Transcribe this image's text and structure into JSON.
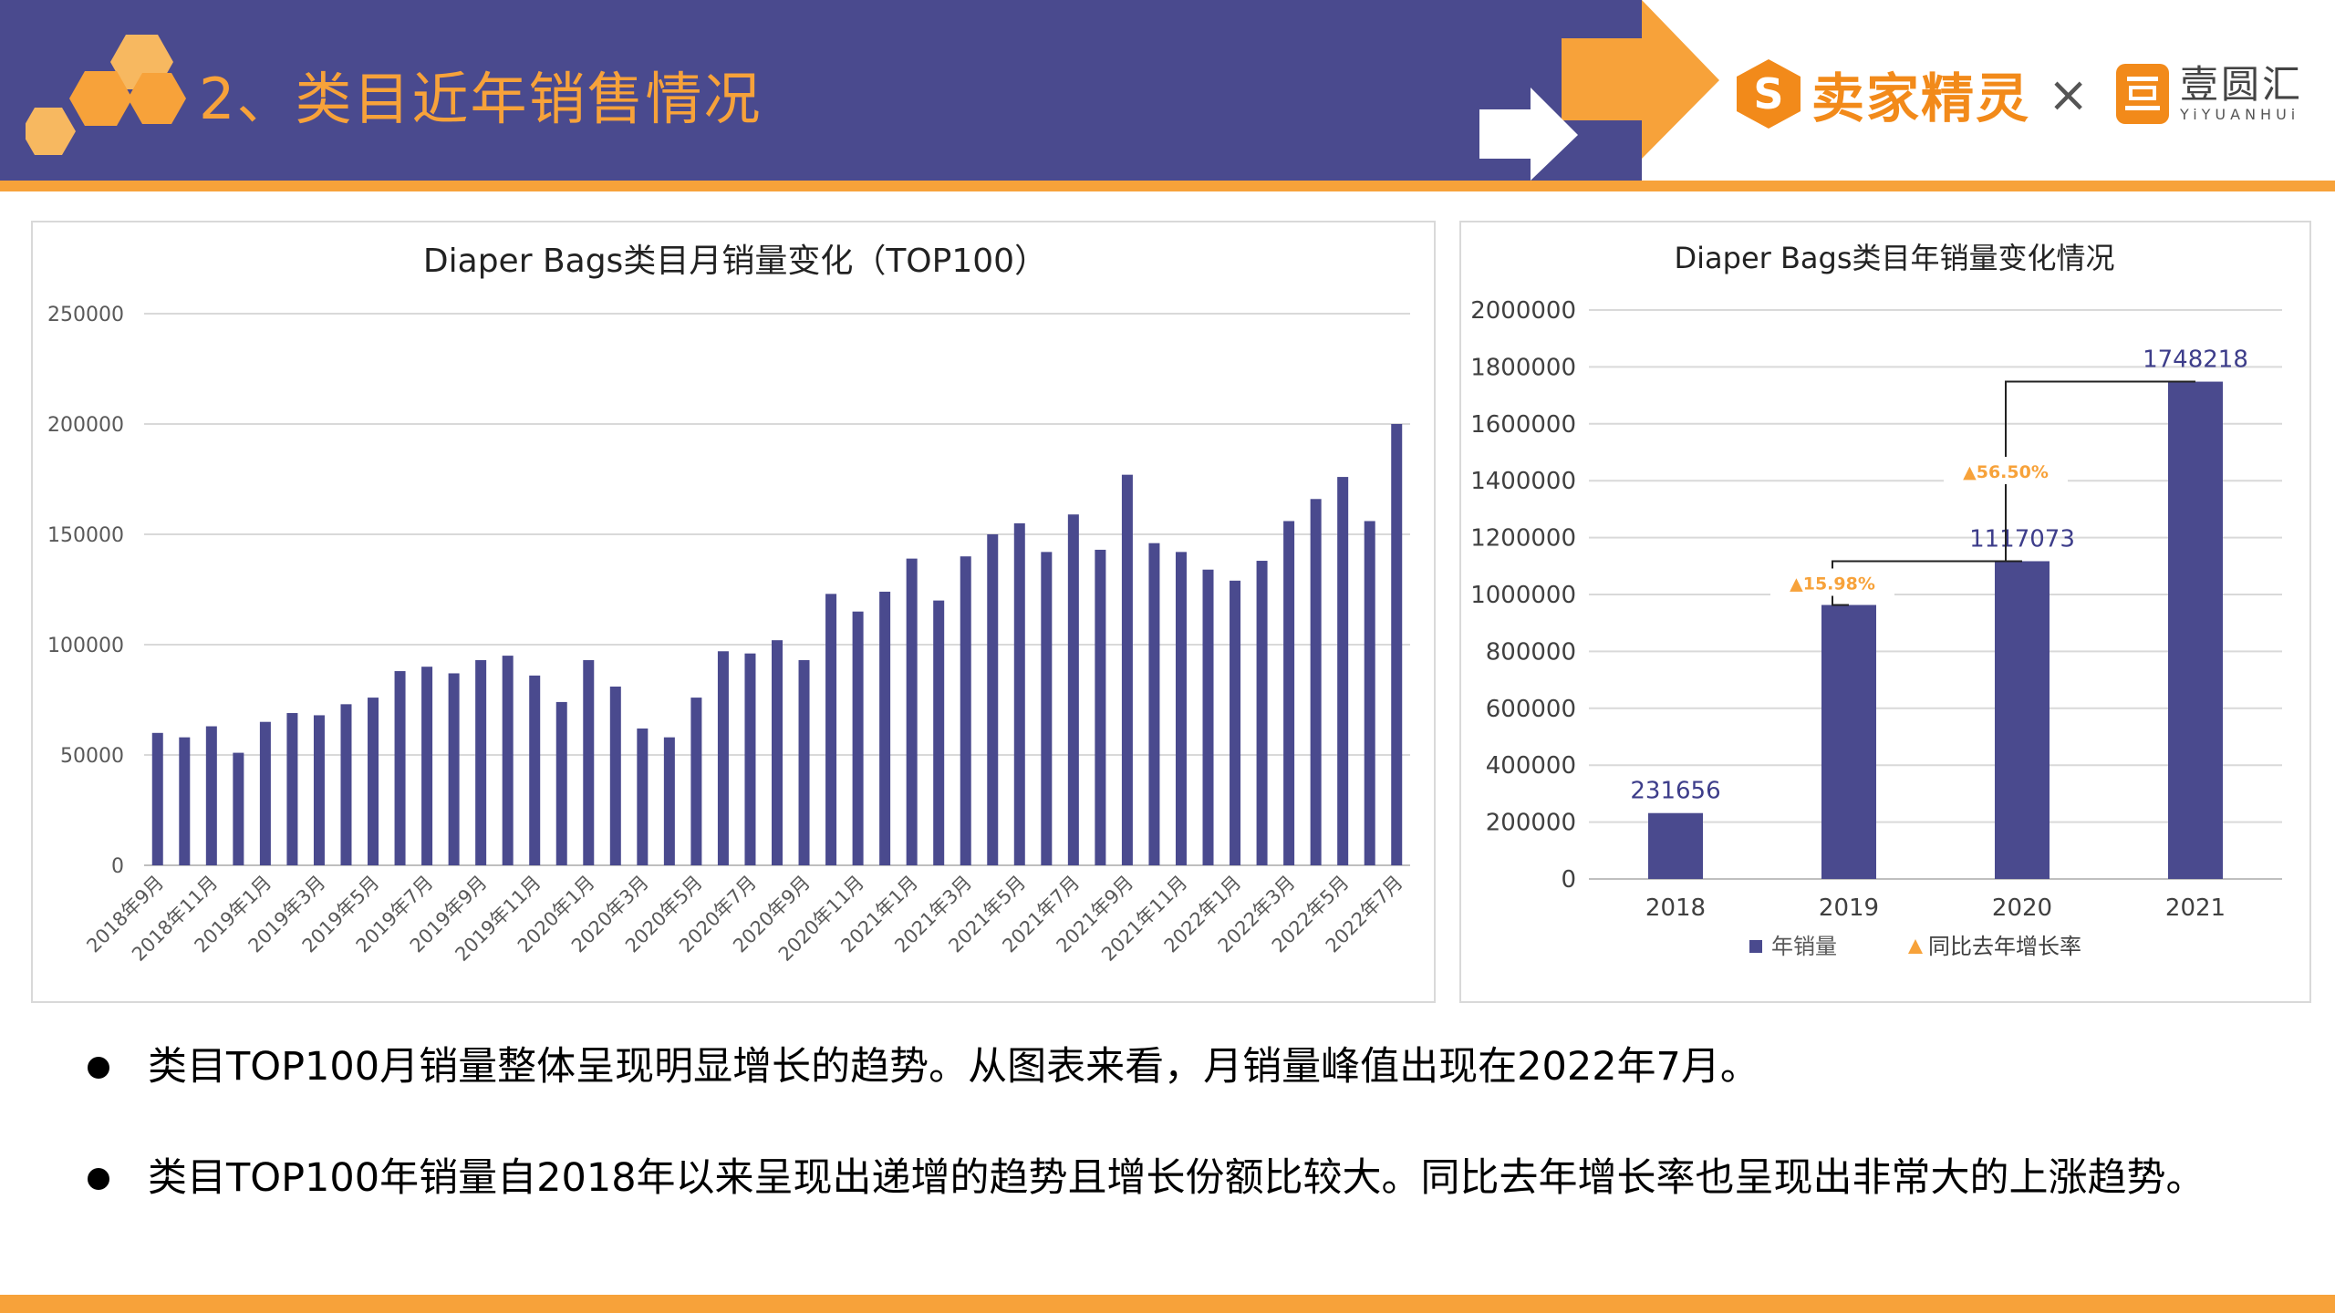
{
  "header": {
    "title": "2、类目近年销售情况",
    "brand_seller": "卖家精灵",
    "times_sign": "×",
    "brand_yyh_cn": "壹圆汇",
    "brand_yyh_en": "YiYUANHUi",
    "colors": {
      "header_bg": "#4a4a8e",
      "accent": "#f7a23a",
      "bar": "#4a4a8e"
    }
  },
  "chart_data": [
    {
      "type": "bar",
      "title": "Diaper Bags类目月销量变化（TOP100）",
      "categories": [
        "2018年9月",
        "2018年10月",
        "2018年11月",
        "2018年12月",
        "2019年1月",
        "2019年2月",
        "2019年3月",
        "2019年4月",
        "2019年5月",
        "2019年6月",
        "2019年7月",
        "2019年8月",
        "2019年9月",
        "2019年10月",
        "2019年11月",
        "2019年12月",
        "2020年1月",
        "2020年2月",
        "2020年3月",
        "2020年4月",
        "2020年5月",
        "2020年6月",
        "2020年7月",
        "2020年8月",
        "2020年9月",
        "2020年10月",
        "2020年11月",
        "2020年12月",
        "2021年1月",
        "2021年2月",
        "2021年3月",
        "2021年4月",
        "2021年5月",
        "2021年6月",
        "2021年7月",
        "2021年8月",
        "2021年9月",
        "2021年10月",
        "2021年11月",
        "2021年12月",
        "2022年1月",
        "2022年2月",
        "2022年3月",
        "2022年4月",
        "2022年5月",
        "2022年6月",
        "2022年7月"
      ],
      "tick_labels": [
        "2018年9月",
        "2018年11月",
        "2019年1月",
        "2019年3月",
        "2019年5月",
        "2019年7月",
        "2019年9月",
        "2019年11月",
        "2020年1月",
        "2020年3月",
        "2020年5月",
        "2020年7月",
        "2020年9月",
        "2020年11月",
        "2021年1月",
        "2021年3月",
        "2021年5月",
        "2021年7月",
        "2021年9月",
        "2021年11月",
        "2022年1月",
        "2022年3月",
        "2022年5月",
        "2022年7月"
      ],
      "values": [
        60000,
        58000,
        63000,
        51000,
        65000,
        69000,
        68000,
        73000,
        76000,
        88000,
        90000,
        87000,
        93000,
        95000,
        86000,
        74000,
        93000,
        81000,
        62000,
        58000,
        76000,
        97000,
        96000,
        102000,
        93000,
        123000,
        115000,
        124000,
        139000,
        120000,
        140000,
        150000,
        155000,
        142000,
        159000,
        143000,
        177000,
        146000,
        142000,
        134000,
        129000,
        138000,
        156000,
        166000,
        176000,
        156000,
        200000
      ],
      "yticks": [
        0,
        50000,
        100000,
        150000,
        200000,
        250000
      ],
      "ylim": [
        0,
        250000
      ]
    },
    {
      "type": "bar",
      "title": "Diaper Bags类目年销量变化情况",
      "categories": [
        "2018",
        "2019",
        "2020",
        "2021"
      ],
      "values": [
        231656,
        963197,
        1117073,
        1748218
      ],
      "yticks": [
        0,
        200000,
        400000,
        600000,
        800000,
        1000000,
        1200000,
        1400000,
        1600000,
        1800000,
        2000000
      ],
      "ylim": [
        0,
        2000000
      ],
      "growth_annotations": [
        "▲15.98%",
        "▲56.50%"
      ],
      "legend": {
        "bar_label": "年销量",
        "growth_label": "同比去年增长率"
      }
    }
  ],
  "bullets": [
    "类目TOP100月销量整体呈现明显增长的趋势。从图表来看，月销量峰值出现在2022年7月。",
    "类目TOP100年销量自2018年以来呈现出递增的趋势且增长份额比较大。同比去年增长率也呈现出非常大的上涨趋势。"
  ]
}
